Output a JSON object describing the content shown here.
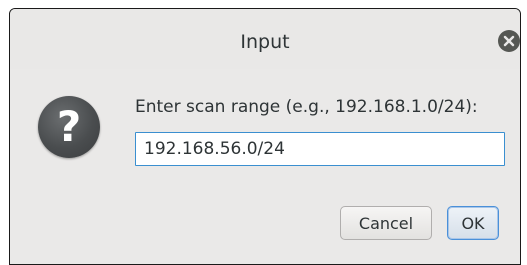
{
  "dialog": {
    "title": "Input",
    "close_icon": "close-icon",
    "question_icon": "question-icon",
    "question_glyph": "?",
    "prompt": "Enter scan range (e.g., 192.168.1.0/24):",
    "input_value": "192.168.56.0/24",
    "buttons": {
      "cancel": "Cancel",
      "ok": "OK"
    }
  },
  "colors": {
    "dialog_bg": "#eae9e8",
    "focus_border": "#3a8fd0",
    "icon_dark": "#555753"
  }
}
